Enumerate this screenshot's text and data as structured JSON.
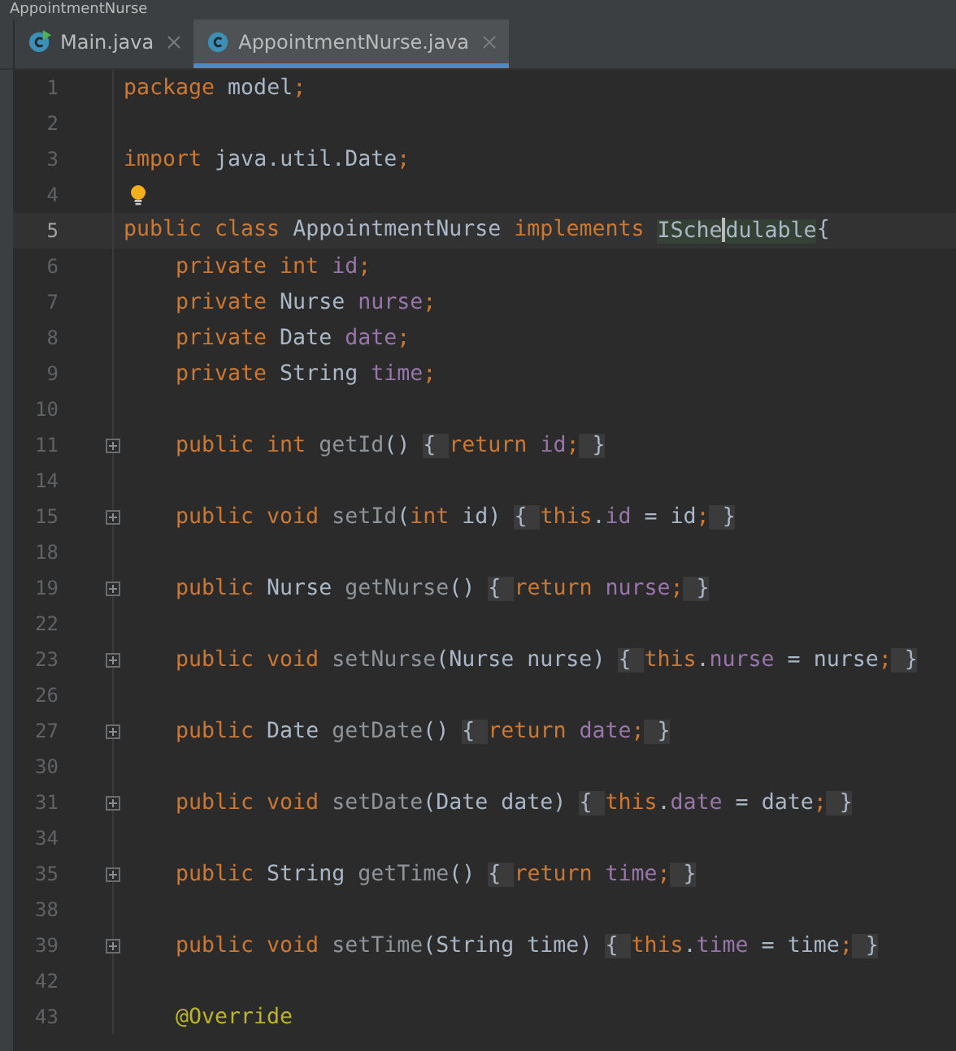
{
  "window": {
    "title": "AppointmentNurse"
  },
  "tabs": [
    {
      "label": "Main.java",
      "selected": false,
      "runnable": true
    },
    {
      "label": "AppointmentNurse.java",
      "selected": true,
      "runnable": false
    }
  ],
  "lines": [
    {
      "number": "1",
      "tokens": [
        {
          "text": "package ",
          "kind": "keyword"
        },
        {
          "text": "model",
          "kind": "plain"
        },
        {
          "text": ";",
          "kind": "keyword"
        }
      ]
    },
    {
      "number": "2"
    },
    {
      "number": "3",
      "tokens": [
        {
          "text": "import ",
          "kind": "keyword"
        },
        {
          "text": "java.util.Date",
          "kind": "plain"
        },
        {
          "text": ";",
          "kind": "keyword"
        }
      ]
    },
    {
      "number": "4",
      "bulb": true
    },
    {
      "number": "5",
      "current": true,
      "tokens": [
        {
          "text": "public class ",
          "kind": "keyword"
        },
        {
          "text": "AppointmentNurse ",
          "kind": "plain"
        },
        {
          "text": "implements ",
          "kind": "keyword"
        },
        {
          "text": "ISche",
          "kind": "usage",
          "caret_after": true
        },
        {
          "text": "dulable",
          "kind": "usage"
        },
        {
          "text": "{",
          "kind": "plain"
        }
      ],
      "children": [
        {
          "number": "6",
          "tokens": [
            {
              "text": "private int ",
              "kind": "keyword"
            },
            {
              "text": "id",
              "kind": "field"
            },
            {
              "text": ";",
              "kind": "keyword"
            }
          ]
        },
        {
          "number": "7",
          "tokens": [
            {
              "text": "private ",
              "kind": "keyword"
            },
            {
              "text": "Nurse ",
              "kind": "plain"
            },
            {
              "text": "nurse",
              "kind": "field"
            },
            {
              "text": ";",
              "kind": "keyword"
            }
          ]
        },
        {
          "number": "8",
          "tokens": [
            {
              "text": "private ",
              "kind": "keyword"
            },
            {
              "text": "Date ",
              "kind": "plain"
            },
            {
              "text": "date",
              "kind": "field"
            },
            {
              "text": ";",
              "kind": "keyword"
            }
          ]
        },
        {
          "number": "9",
          "tokens": [
            {
              "text": "private ",
              "kind": "keyword"
            },
            {
              "text": "String ",
              "kind": "plain"
            },
            {
              "text": "time",
              "kind": "field"
            },
            {
              "text": ";",
              "kind": "keyword"
            }
          ]
        },
        {
          "number": "10"
        },
        {
          "number": "11",
          "foldable": true,
          "tokens": [
            {
              "text": "public int ",
              "kind": "keyword"
            },
            {
              "text": "getId",
              "kind": "method"
            },
            {
              "text": "() ",
              "kind": "plain"
            },
            {
              "text": "{ ",
              "kind": "fold"
            },
            {
              "text": "return ",
              "kind": "keyword"
            },
            {
              "text": "id",
              "kind": "field"
            },
            {
              "text": ";",
              "kind": "keyword"
            },
            {
              "text": " }",
              "kind": "fold"
            }
          ]
        },
        {
          "number": "14"
        },
        {
          "number": "15",
          "foldable": true,
          "tokens": [
            {
              "text": "public void ",
              "kind": "keyword"
            },
            {
              "text": "setId",
              "kind": "method"
            },
            {
              "text": "(",
              "kind": "plain"
            },
            {
              "text": "int ",
              "kind": "keyword"
            },
            {
              "text": "id) ",
              "kind": "plain"
            },
            {
              "text": "{ ",
              "kind": "fold"
            },
            {
              "text": "this",
              "kind": "keyword"
            },
            {
              "text": ".",
              "kind": "plain"
            },
            {
              "text": "id",
              "kind": "field"
            },
            {
              "text": " = id",
              "kind": "plain"
            },
            {
              "text": ";",
              "kind": "keyword"
            },
            {
              "text": " }",
              "kind": "fold"
            }
          ]
        },
        {
          "number": "18"
        },
        {
          "number": "19",
          "foldable": true,
          "tokens": [
            {
              "text": "public ",
              "kind": "keyword"
            },
            {
              "text": "Nurse ",
              "kind": "plain"
            },
            {
              "text": "getNurse",
              "kind": "method"
            },
            {
              "text": "() ",
              "kind": "plain"
            },
            {
              "text": "{ ",
              "kind": "fold"
            },
            {
              "text": "return ",
              "kind": "keyword"
            },
            {
              "text": "nurse",
              "kind": "field"
            },
            {
              "text": ";",
              "kind": "keyword"
            },
            {
              "text": " }",
              "kind": "fold"
            }
          ]
        },
        {
          "number": "22"
        },
        {
          "number": "23",
          "foldable": true,
          "tokens": [
            {
              "text": "public void ",
              "kind": "keyword"
            },
            {
              "text": "setNurse",
              "kind": "method"
            },
            {
              "text": "(Nurse nurse) ",
              "kind": "plain"
            },
            {
              "text": "{ ",
              "kind": "fold"
            },
            {
              "text": "this",
              "kind": "keyword"
            },
            {
              "text": ".",
              "kind": "plain"
            },
            {
              "text": "nurse",
              "kind": "field"
            },
            {
              "text": " = nurse",
              "kind": "plain"
            },
            {
              "text": ";",
              "kind": "keyword"
            },
            {
              "text": " }",
              "kind": "fold"
            }
          ]
        },
        {
          "number": "26"
        },
        {
          "number": "27",
          "foldable": true,
          "tokens": [
            {
              "text": "public ",
              "kind": "keyword"
            },
            {
              "text": "Date ",
              "kind": "plain"
            },
            {
              "text": "getDate",
              "kind": "method"
            },
            {
              "text": "() ",
              "kind": "plain"
            },
            {
              "text": "{ ",
              "kind": "fold"
            },
            {
              "text": "return ",
              "kind": "keyword"
            },
            {
              "text": "date",
              "kind": "field"
            },
            {
              "text": ";",
              "kind": "keyword"
            },
            {
              "text": " }",
              "kind": "fold"
            }
          ]
        },
        {
          "number": "30"
        },
        {
          "number": "31",
          "foldable": true,
          "tokens": [
            {
              "text": "public void ",
              "kind": "keyword"
            },
            {
              "text": "setDate",
              "kind": "method"
            },
            {
              "text": "(Date date) ",
              "kind": "plain"
            },
            {
              "text": "{ ",
              "kind": "fold"
            },
            {
              "text": "this",
              "kind": "keyword"
            },
            {
              "text": ".",
              "kind": "plain"
            },
            {
              "text": "date",
              "kind": "field"
            },
            {
              "text": " = date",
              "kind": "plain"
            },
            {
              "text": ";",
              "kind": "keyword"
            },
            {
              "text": " }",
              "kind": "fold"
            }
          ]
        },
        {
          "number": "34"
        },
        {
          "number": "35",
          "foldable": true,
          "tokens": [
            {
              "text": "public ",
              "kind": "keyword"
            },
            {
              "text": "String ",
              "kind": "plain"
            },
            {
              "text": "getTime",
              "kind": "method"
            },
            {
              "text": "() ",
              "kind": "plain"
            },
            {
              "text": "{ ",
              "kind": "fold"
            },
            {
              "text": "return ",
              "kind": "keyword"
            },
            {
              "text": "time",
              "kind": "field"
            },
            {
              "text": ";",
              "kind": "keyword"
            },
            {
              "text": " }",
              "kind": "fold"
            }
          ]
        },
        {
          "number": "38"
        },
        {
          "number": "39",
          "foldable": true,
          "tokens": [
            {
              "text": "public void ",
              "kind": "keyword"
            },
            {
              "text": "setTime",
              "kind": "method"
            },
            {
              "text": "(String time) ",
              "kind": "plain"
            },
            {
              "text": "{ ",
              "kind": "fold"
            },
            {
              "text": "this",
              "kind": "keyword"
            },
            {
              "text": ".",
              "kind": "plain"
            },
            {
              "text": "time",
              "kind": "field"
            },
            {
              "text": " = time",
              "kind": "plain"
            },
            {
              "text": ";",
              "kind": "keyword"
            },
            {
              "text": " }",
              "kind": "fold"
            }
          ]
        },
        {
          "number": "42"
        },
        {
          "number": "43",
          "tokens": [
            {
              "text": "@Override",
              "kind": "annotation"
            }
          ]
        }
      ]
    }
  ]
}
